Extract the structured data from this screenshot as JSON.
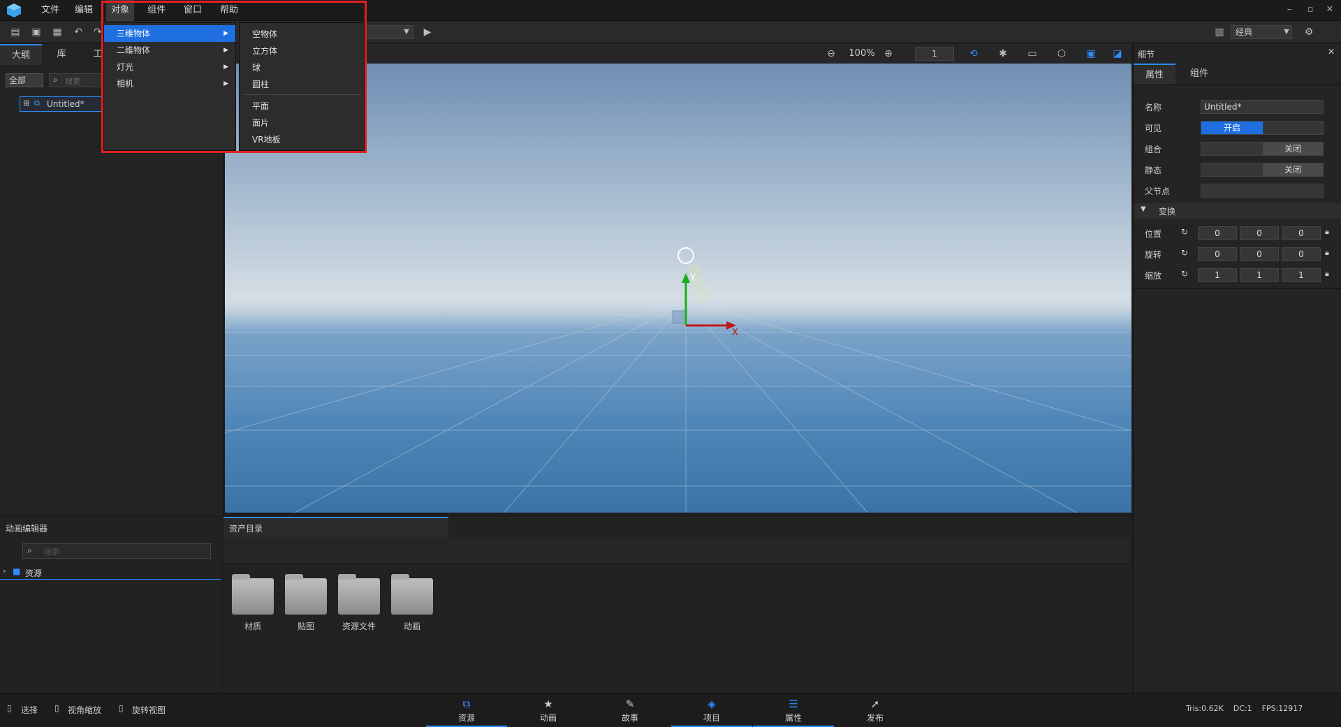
{
  "menubar": {
    "items": [
      "文件",
      "编辑",
      "对象",
      "组件",
      "窗口",
      "帮助"
    ],
    "active": "对象"
  },
  "toolbar": {
    "layout_select": "经典"
  },
  "left_panel": {
    "tabs": [
      "大纲",
      "库",
      "工"
    ],
    "filter": "全部",
    "search_placeholder": "搜索",
    "tree_item": "Untitled*"
  },
  "viewport_bar": {
    "zoom": "100%",
    "step": "1"
  },
  "dropdown": {
    "items": [
      {
        "label": "三维物体",
        "selected": true
      },
      {
        "label": "二维物体",
        "selected": false
      },
      {
        "label": "灯光",
        "selected": false
      },
      {
        "label": "相机",
        "selected": false
      }
    ]
  },
  "submenu": {
    "group1": [
      "空物体",
      "立方体",
      "球",
      "圆柱"
    ],
    "group2": [
      "平面",
      "面片",
      "VR地板"
    ]
  },
  "right_panel": {
    "title": "细节",
    "tabs": [
      "属性",
      "组件"
    ],
    "name_label": "名称",
    "name_value": "Untitled*",
    "visible_label": "可见",
    "visible_value": "开启",
    "group_label": "组合",
    "group_value": "关闭",
    "static_label": "静态",
    "static_value": "关闭",
    "parent_label": "父节点",
    "transform_label": "变换",
    "position_label": "位置",
    "rotation_label": "旋转",
    "scale_label": "缩放",
    "position": [
      "0",
      "0",
      "0"
    ],
    "rotation": [
      "0",
      "0",
      "0"
    ],
    "scale": [
      "1",
      "1",
      "1"
    ]
  },
  "anim_editor": {
    "title": "动画编辑器",
    "search_placeholder": "搜索",
    "tree_root": "资源"
  },
  "assets": {
    "title": "资产目录",
    "folders": [
      "材质",
      "贴图",
      "资源文件",
      "动画"
    ]
  },
  "statusbar": {
    "tools": [
      "选择",
      "视角缩放",
      "旋转视图"
    ],
    "nav": [
      "资源",
      "动画",
      "故事",
      "项目",
      "属性",
      "发布"
    ],
    "stats": "Tris:0.62K    DC:1    FPS:12917"
  },
  "gizmo": {
    "x": "X",
    "y": "Y"
  },
  "colors": {
    "accent": "#2d8cff",
    "highlight": "#e02020"
  }
}
